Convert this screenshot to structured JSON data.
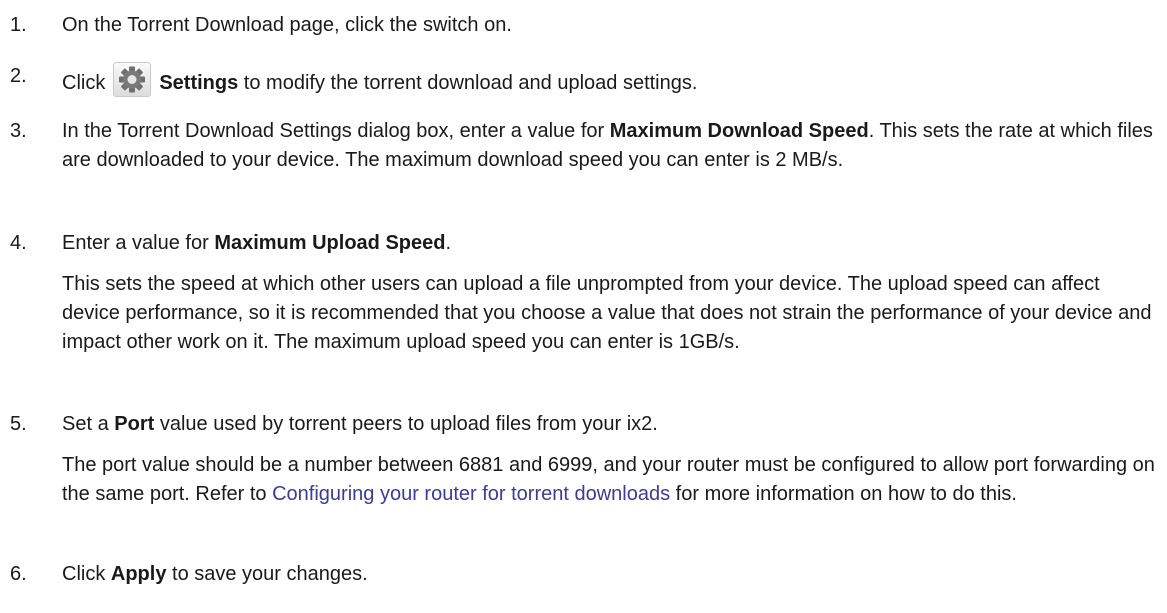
{
  "steps": [
    {
      "number": "1.",
      "text": "On the Torrent Download page, click the switch on."
    },
    {
      "number": "2.",
      "before": "Click",
      "icon": "gear-icon",
      "bold": "Settings",
      "after": " to modify the torrent download and upload settings."
    },
    {
      "number": "3.",
      "before": "In the Torrent Download Settings dialog box, enter a value for ",
      "bold": "Maximum Download Speed",
      "after": ". This sets the rate at which files are downloaded to your device. The maximum download speed you can enter is 2 MB/s."
    },
    {
      "number": "4.",
      "before": "Enter a value for ",
      "bold": "Maximum Upload Speed",
      "after": ".",
      "para2": "This sets the speed at which other users can upload a file unprompted from your device. The upload speed can affect device performance, so it is recommended that you choose a value that does not strain the performance of your device and impact other work on it. The maximum upload speed you can enter is 1GB/s."
    },
    {
      "number": "5.",
      "before": "Set a ",
      "bold": "Port",
      "after": " value used by torrent peers to upload files from your ix2.",
      "para2_before": "The port value should be a number between 6881 and 6999, and your router must be configured to allow port forwarding on the same port. Refer to ",
      "para2_link": "Configuring your router for torrent downloads",
      "para2_after": " for more information on how to do this."
    },
    {
      "number": "6.",
      "before": "Click ",
      "bold": "Apply",
      "after": " to save your changes."
    }
  ],
  "colors": {
    "text": "#1a1a1a",
    "link": "#3b3b9a"
  }
}
